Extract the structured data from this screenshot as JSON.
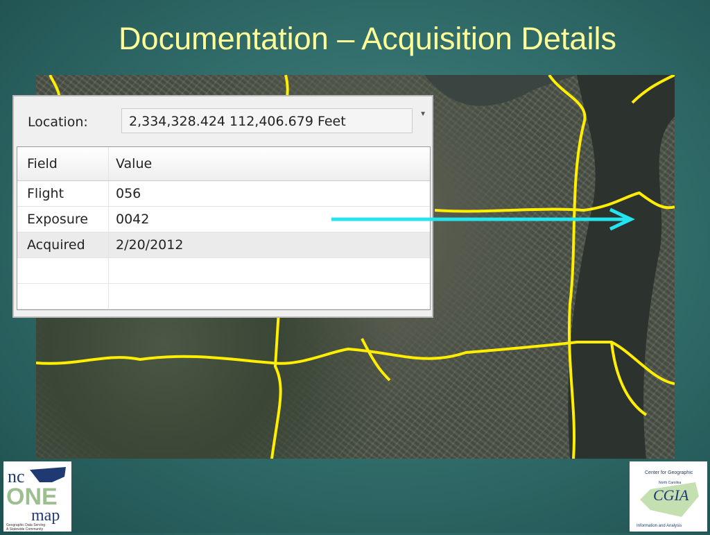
{
  "slide": {
    "title": "Documentation – Acquisition Details"
  },
  "panel": {
    "location_label": "Location:",
    "location_value": "2,334,328.424  112,406.679 Feet",
    "columns": [
      "Field",
      "Value"
    ],
    "rows": [
      {
        "field": "Flight",
        "value": "056"
      },
      {
        "field": "Exposure",
        "value": "0042"
      },
      {
        "field": "Acquired",
        "value": "2/20/2012"
      }
    ]
  },
  "logos": {
    "left": {
      "nc": "nc",
      "one": "ONE",
      "map": "map",
      "tagline1": "Geographic Data Serving",
      "tagline2": "A Statewide Community"
    },
    "right": {
      "top": "Center for Geographic",
      "state": "North Carolina",
      "name": "CGIA",
      "bottom": "Information and Analysis"
    }
  },
  "colors": {
    "title": "#ffff99",
    "arrow": "#22e5f0",
    "boundary": "#ffee00"
  }
}
